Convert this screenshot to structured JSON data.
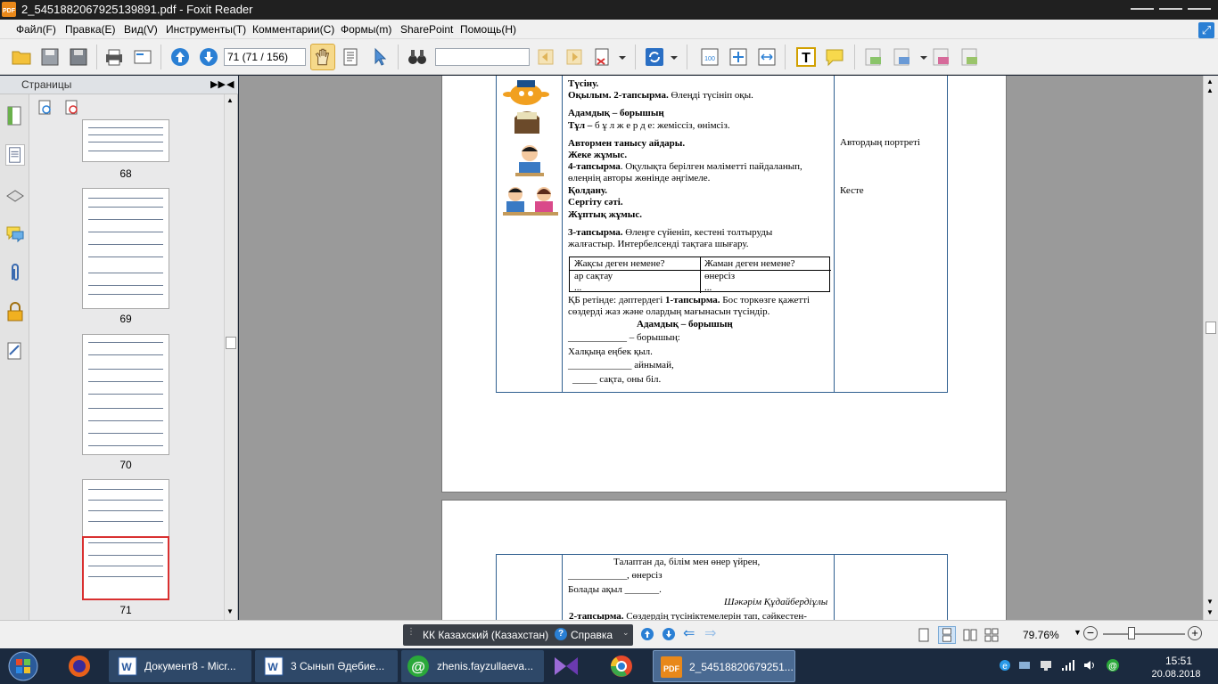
{
  "window": {
    "title": "2_5451882067925139891.pdf - Foxit Reader",
    "app_icon_text": "PDF"
  },
  "menu": {
    "items": [
      "Файл(F)",
      "Правка(E)",
      "Вид(V)",
      "Инструменты(T)",
      "Комментарии(C)",
      "Формы(m)",
      "SharePoint",
      "Помощь(H)"
    ]
  },
  "toolbar": {
    "page_field_value": "71 (71 / 156)",
    "search_value": ""
  },
  "pages_panel": {
    "title": "Страницы",
    "thumbnails": [
      {
        "label": "68"
      },
      {
        "label": "69"
      },
      {
        "label": "70"
      },
      {
        "label": "71"
      }
    ],
    "selected_page": "71"
  },
  "document": {
    "page1": {
      "lines": [
        {
          "text": "Түсіну.",
          "bold": true
        },
        {
          "text": "Оқылым. 2-тапсырма.",
          "bold": true,
          "rest": " Өлеңді түсініп оқы."
        },
        {
          "text": "Адамдық – борышың",
          "bold": true
        },
        {
          "text": "Тұл –",
          "bold": true,
          "rest": " б ұ л   ж е р д е:  жемiссiз, өнiмсiз."
        },
        {
          "text": "Автормен танысу айдары.",
          "bold": true
        },
        {
          "text": "Жеке жұмыс.",
          "bold": true
        },
        {
          "text": "4-тапсырма",
          "bold": true,
          "rest": ". Оқулықта берілген мәліметті пайдаланып,"
        },
        {
          "text": "",
          "bold": false,
          "rest": "өлеңнің авторы жөнінде әңгімеле."
        },
        {
          "text": "Қолдану.",
          "bold": true
        },
        {
          "text": "Сергіту сәті.",
          "bold": true
        },
        {
          "text": "Жұптық жұмыс.",
          "bold": true
        },
        {
          "text": "3-тапсырма.",
          "bold": true,
          "rest": " Өлеңге сүйеніп, кестені толтыруды"
        },
        {
          "text": "",
          "bold": false,
          "rest": "жалғастыр. Интербелсенді тақтаға шығару."
        }
      ],
      "resources_col": [
        "Автордың портреті",
        "Кесте"
      ],
      "inner_table": {
        "headers": [
          "Жақсы деген немене?",
          "Жаман деген немене?"
        ],
        "row1": [
          "ар сақтау",
          "өнерсіз"
        ],
        "row2": [
          "...",
          "..."
        ]
      },
      "after_table": [
        {
          "text": " ҚБ ретінде: дәптердегі ",
          "bold_part": "1-тапсырма.",
          "rest": " Бос торкөзге қажетті"
        },
        {
          "text": "сөздерді жаз және олардың мағынасын түсіндір."
        }
      ],
      "poem_title": "Адамдық – борышың",
      "poem_lines": [
        "____________ – борышың:",
        "Халқыңа еңбек қыл.",
        "_____________ айнымай,",
        "_____ сақта, оны біл."
      ]
    },
    "page2": {
      "lines": [
        "Талаптан да, білім мен өнер үйрен,",
        "____________, өнерсіз",
        "Болады ақыл _______."
      ],
      "author": "Шәкәрім Құдайбердіұлы",
      "task": {
        "bold": "2-тапсырма.",
        "rest": " Сөздердің түсініктемелерін тап, сәйкестен-"
      }
    }
  },
  "statusbar": {
    "language": "КК Казахский (Казахстан)",
    "help": "Справка",
    "zoom": "79.76%"
  },
  "taskbar": {
    "tasks": [
      {
        "label": "Документ8 - Micr..."
      },
      {
        "label": "3 Сынып Әдебие..."
      },
      {
        "label": "zhenis.fayzullaeva..."
      },
      {
        "label": "2_54518820679251..."
      }
    ],
    "clock_time": "15:51",
    "clock_date": "20.08.2018"
  },
  "colors": {
    "titlebar": "#202020",
    "accent_blue": "#2a7fd4",
    "selection_red": "#d93030",
    "foxit_orange": "#e8881a",
    "table_border": "#2f5f8f"
  }
}
